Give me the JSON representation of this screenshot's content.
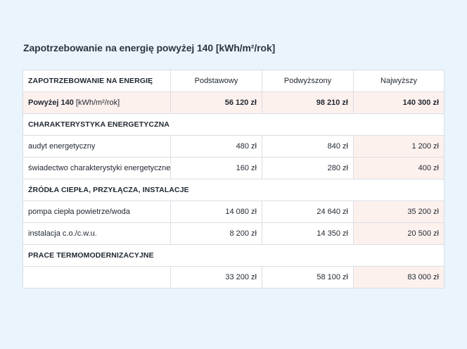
{
  "title": "Zapotrzebowanie na energię powyżej 140 [kWh/m²/rok]",
  "table": {
    "headers": [
      "ZAPOTRZEBOWANIE NA ENERGIĘ",
      "Podstawowy",
      "Podwyższony",
      "Najwyższy"
    ],
    "highlight_row": {
      "label_strong": "Powyżej 140",
      "label_rest": " [kWh/m²/rok]",
      "values": [
        "56 120 zł",
        "98 210 zł",
        "140 300 zł"
      ]
    },
    "sections": [
      {
        "title": "CHARAKTERYSTYKA ENERGETYCZNA",
        "rows": [
          {
            "label": "audyt energetyczny",
            "values": [
              "480 zł",
              "840 zł",
              "1 200 zł"
            ]
          },
          {
            "label": "świadectwo charakterystyki energetycznej",
            "values": [
              "160 zł",
              "280 zł",
              "400 zł"
            ]
          }
        ]
      },
      {
        "title": "ŹRÓDŁA CIEPŁA, PRZYŁĄCZA, INSTALACJE",
        "rows": [
          {
            "label": "pompa ciepła powietrze/woda",
            "values": [
              "14 080 zł",
              "24 640 zł",
              "35 200 zł"
            ]
          },
          {
            "label": "instalacja c.o./c.w.u.",
            "values": [
              "8 200 zł",
              "14 350 zł",
              "20 500 zł"
            ]
          }
        ]
      },
      {
        "title": "PRACE TERMOMODERNIZACYJNE",
        "rows": [
          {
            "label": "",
            "values": [
              "33 200 zł",
              "58 100 zł",
              "83 000 zł"
            ]
          }
        ]
      }
    ]
  }
}
